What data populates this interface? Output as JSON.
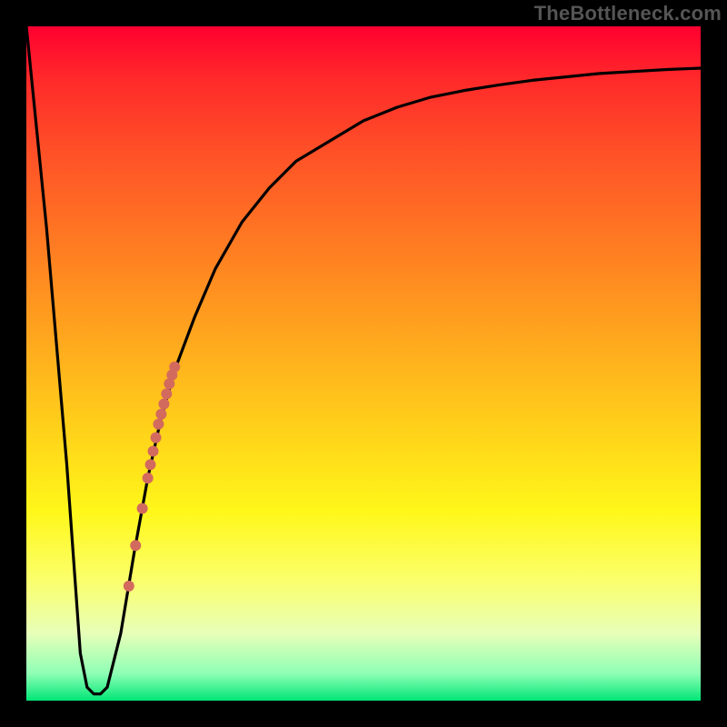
{
  "watermark": "TheBottleneck.com",
  "chart_data": {
    "type": "line",
    "title": "",
    "xlabel": "",
    "ylabel": "",
    "xlim": [
      0,
      100
    ],
    "ylim": [
      0,
      100
    ],
    "grid": false,
    "legend": false,
    "series": [
      {
        "name": "bottleneck-curve",
        "x": [
          0,
          3,
          6,
          8,
          9,
          10,
          11,
          12,
          14,
          16,
          18,
          20,
          22,
          25,
          28,
          32,
          36,
          40,
          45,
          50,
          55,
          60,
          65,
          70,
          75,
          80,
          85,
          90,
          95,
          100
        ],
        "y": [
          100,
          70,
          35,
          7,
          2,
          1,
          1,
          2,
          10,
          22,
          33,
          42,
          49,
          57,
          64,
          71,
          76,
          80,
          83,
          86,
          88,
          89.5,
          90.5,
          91.3,
          92,
          92.5,
          93,
          93.3,
          93.6,
          93.8
        ]
      }
    ],
    "highlight_points": {
      "name": "highlight-segment",
      "color": "#d36a5e",
      "points": [
        {
          "x": 18.0,
          "y": 33.0,
          "r": 6
        },
        {
          "x": 18.4,
          "y": 35.0,
          "r": 6
        },
        {
          "x": 18.8,
          "y": 37.0,
          "r": 6
        },
        {
          "x": 19.2,
          "y": 39.0,
          "r": 6
        },
        {
          "x": 19.6,
          "y": 41.0,
          "r": 6
        },
        {
          "x": 20.0,
          "y": 42.5,
          "r": 6
        },
        {
          "x": 20.4,
          "y": 44.0,
          "r": 6
        },
        {
          "x": 20.8,
          "y": 45.5,
          "r": 6
        },
        {
          "x": 21.2,
          "y": 47.0,
          "r": 6
        },
        {
          "x": 21.6,
          "y": 48.3,
          "r": 6
        },
        {
          "x": 22.0,
          "y": 49.5,
          "r": 6
        },
        {
          "x": 17.2,
          "y": 28.5,
          "r": 6
        },
        {
          "x": 16.2,
          "y": 23.0,
          "r": 6
        },
        {
          "x": 15.2,
          "y": 17.0,
          "r": 6
        }
      ]
    },
    "gradient_stops": [
      {
        "pos": 0.0,
        "color": "#ff0030"
      },
      {
        "pos": 0.2,
        "color": "#ff5527"
      },
      {
        "pos": 0.45,
        "color": "#ffa31e"
      },
      {
        "pos": 0.72,
        "color": "#fff71a"
      },
      {
        "pos": 0.9,
        "color": "#e7ffb8"
      },
      {
        "pos": 1.0,
        "color": "#00e676"
      }
    ]
  }
}
